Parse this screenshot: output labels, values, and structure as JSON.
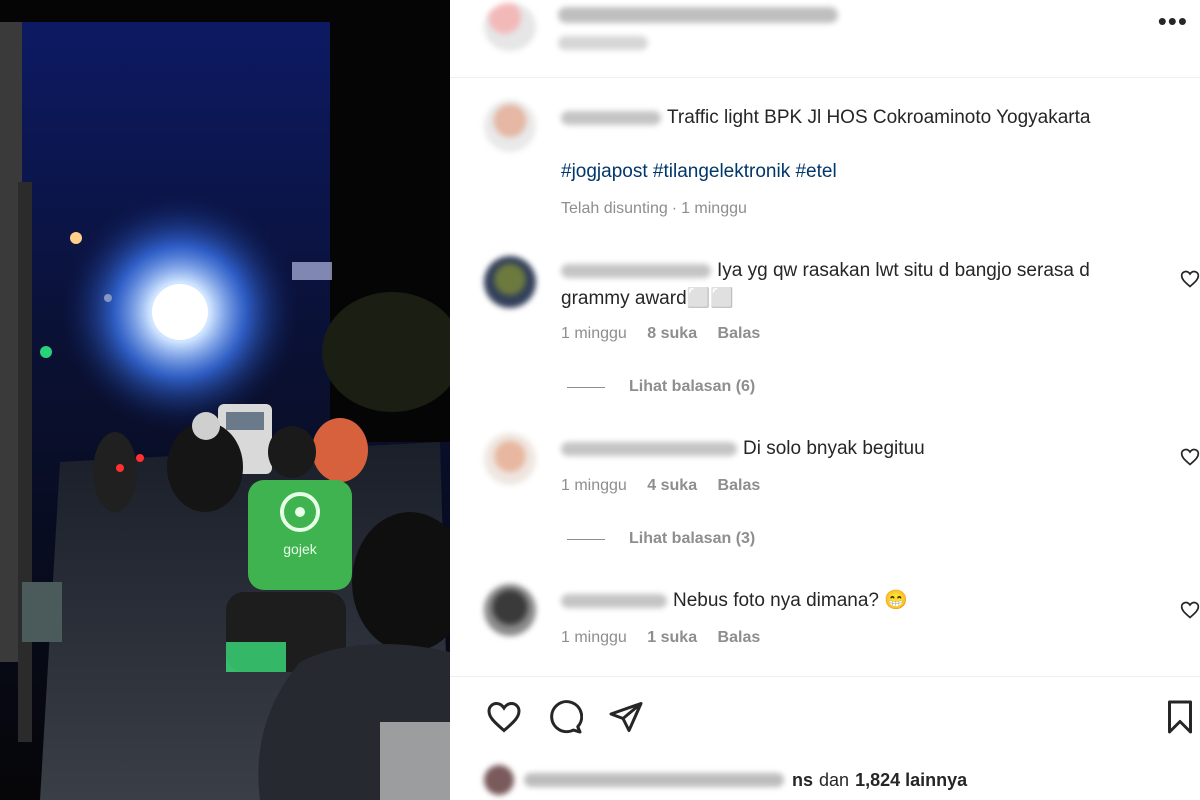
{
  "post": {
    "header": {
      "more_label": "•••"
    },
    "caption": {
      "text": "Traffic light BPK Jl HOS Cokroaminoto Yogyakarta",
      "hashtags": "#jogjapost #tilangelektronik #etel",
      "edited": "Telah disunting",
      "separator": "·",
      "time": "1 minggu"
    },
    "comments": [
      {
        "line1": "Iya yg qw rasakan lwt situ d bangjo serasa d",
        "line2": "grammy award⬜⬜",
        "time": "1 minggu",
        "likes": "8 suka",
        "reply": "Balas",
        "view_replies": "Lihat balasan (6)"
      },
      {
        "line1": "Di solo bnyak begituu",
        "time": "1 minggu",
        "likes": "4 suka",
        "reply": "Balas",
        "view_replies": "Lihat balasan (3)"
      },
      {
        "line1": "Nebus foto nya dimana? 😁",
        "time": "1 minggu",
        "likes": "1 suka",
        "reply": "Balas"
      }
    ],
    "liked_by": {
      "suffix": "ns",
      "conjunction": "dan",
      "others": "1,824 lainnya"
    }
  },
  "icons": {
    "like": "heart-icon",
    "comment": "comment-icon",
    "share": "send-icon",
    "save": "bookmark-icon",
    "more": "more-icon"
  },
  "colors": {
    "hashtag": "#00376b",
    "meta": "#8e8e8e",
    "text": "#262626",
    "gojek_green": "#3fb34f"
  }
}
